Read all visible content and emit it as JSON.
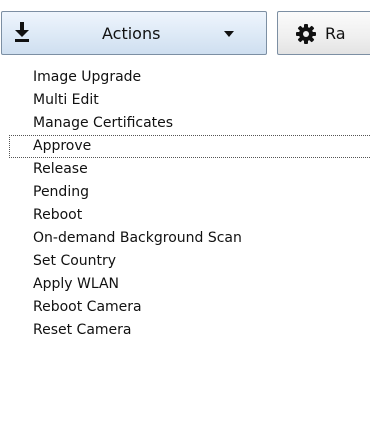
{
  "toolbar": {
    "actions_label": "Actions",
    "second_button_label": "Ra"
  },
  "menu": {
    "focused_index": 3,
    "items": [
      {
        "label": "Image Upgrade"
      },
      {
        "label": "Multi Edit"
      },
      {
        "label": "Manage Certificates"
      },
      {
        "label": "Approve"
      },
      {
        "label": "Release"
      },
      {
        "label": "Pending"
      },
      {
        "label": "Reboot"
      },
      {
        "label": "On-demand Background Scan"
      },
      {
        "label": "Set Country"
      },
      {
        "label": "Apply WLAN"
      },
      {
        "label": "Reboot Camera"
      },
      {
        "label": "Reset Camera"
      }
    ]
  },
  "icons": {
    "actions_button_icon": "download-icon",
    "actions_dropdown_icon": "caret-down-icon",
    "second_button_icon": "gear-icon"
  },
  "colors": {
    "actions_button_top": "#eef5fd",
    "actions_button_bottom": "#cfdff0",
    "button_border": "#7c8fa3",
    "text": "#111111",
    "focus_outline": "#555555"
  }
}
